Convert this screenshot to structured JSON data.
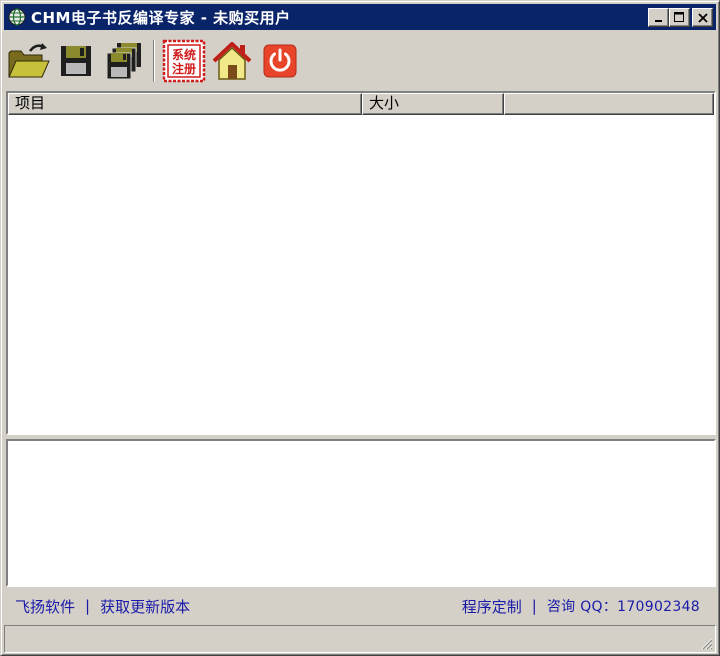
{
  "window": {
    "title": "CHM电子书反编译专家 - 未购买用户",
    "app_icon": "globe-icon"
  },
  "title_buttons": {
    "minimize_icon": "minimize-icon",
    "maximize_icon": "maximize-icon",
    "close_icon": "close-icon"
  },
  "toolbar": {
    "items": [
      {
        "name": "open-folder",
        "icon": "open-folder-icon"
      },
      {
        "name": "save",
        "icon": "floppy-disk-icon"
      },
      {
        "name": "save-all",
        "icon": "multiple-floppy-icon"
      },
      {
        "name": "register",
        "icon": "register-stamp-icon",
        "label_line1": "系统",
        "label_line2": "注册"
      },
      {
        "name": "home",
        "icon": "home-icon"
      },
      {
        "name": "exit",
        "icon": "power-icon"
      }
    ]
  },
  "list": {
    "columns": [
      "项目",
      "大小",
      ""
    ],
    "rows": []
  },
  "links": {
    "left": [
      "飞扬软件",
      "获取更新版本"
    ],
    "right_custom": "程序定制",
    "right_contact": "咨询 QQ：170902348",
    "separator": "|"
  },
  "colors": {
    "titlebar": "#0a246a",
    "face": "#d4d0c8",
    "link": "#1a1aa8",
    "stamp_red": "#d01c1c"
  }
}
